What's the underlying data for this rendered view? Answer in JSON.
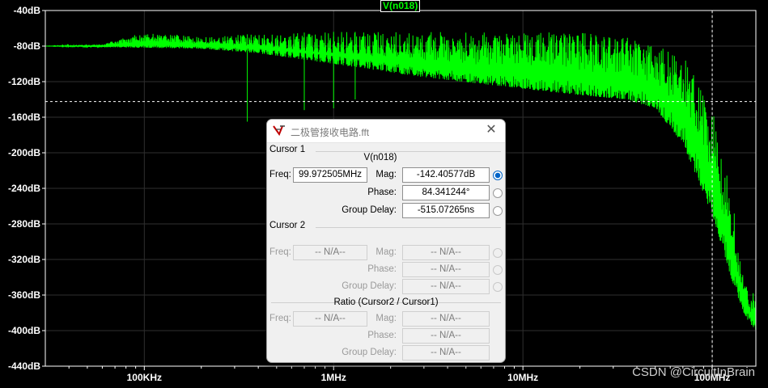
{
  "chart_data": {
    "type": "line",
    "title": "V(n018)",
    "series": [
      {
        "name": "V(n018)",
        "color": "#00ff00"
      }
    ],
    "x_scale": "log",
    "xlim": [
      30000,
      170000000
    ],
    "ylim": [
      -440,
      -40
    ],
    "y_ticks": [
      -40,
      -80,
      -120,
      -160,
      -200,
      -240,
      -280,
      -320,
      -360,
      -400,
      -440
    ],
    "y_tick_labels": [
      "-40dB",
      "-80dB",
      "-120dB",
      "-160dB",
      "-200dB",
      "-240dB",
      "-280dB",
      "-320dB",
      "-360dB",
      "-400dB",
      "-440dB"
    ],
    "x_ticks": [
      100000,
      1000000,
      10000000,
      100000000
    ],
    "x_tick_labels": [
      "100KHz",
      "1MHz",
      "10MHz",
      "100MHz"
    ],
    "grid": true,
    "envelope": {
      "upper": [
        [
          30000,
          -80
        ],
        [
          60000,
          -78
        ],
        [
          80000,
          -70
        ],
        [
          100000,
          -65
        ],
        [
          130000,
          -66
        ],
        [
          200000,
          -70
        ],
        [
          400000,
          -66
        ],
        [
          1000000,
          -64
        ],
        [
          3000000,
          -64
        ],
        [
          10000000,
          -64
        ],
        [
          20000000,
          -65
        ],
        [
          40000000,
          -70
        ],
        [
          70000000,
          -90
        ],
        [
          100000000,
          -150
        ],
        [
          130000000,
          -260
        ],
        [
          140000000,
          -320
        ],
        [
          160000000,
          -360
        ],
        [
          170000000,
          -350
        ]
      ],
      "lower": [
        [
          30000,
          -80
        ],
        [
          200000,
          -83
        ],
        [
          400000,
          -88
        ],
        [
          1000000,
          -100
        ],
        [
          3000000,
          -115
        ],
        [
          10000000,
          -128
        ],
        [
          20000000,
          -135
        ],
        [
          35000000,
          -140
        ],
        [
          50000000,
          -150
        ],
        [
          70000000,
          -190
        ],
        [
          100000000,
          -270
        ],
        [
          130000000,
          -350
        ],
        [
          150000000,
          -385
        ],
        [
          170000000,
          -400
        ]
      ]
    },
    "notches": [
      [
        350000,
        -165
      ],
      [
        700000,
        -152
      ],
      [
        1000000,
        -150
      ],
      [
        1300000,
        -140
      ]
    ],
    "cursor": {
      "x": 99972505,
      "y": -142.40577
    }
  },
  "window": {
    "title": "二极管接收电路.fft",
    "close_glyph": "✕"
  },
  "cursor1": {
    "group_label": "Cursor 1",
    "trace": "V(n018)",
    "freq_label": "Freq:",
    "freq": "99.972505MHz",
    "mag_label": "Mag:",
    "mag": "-142.40577dB",
    "phase_label": "Phase:",
    "phase": "84.341244°",
    "gd_label": "Group Delay:",
    "gd": "-515.07265ns"
  },
  "cursor2": {
    "group_label": "Cursor 2",
    "freq_label": "Freq:",
    "freq": "-- N/A--",
    "mag_label": "Mag:",
    "mag": "-- N/A--",
    "phase_label": "Phase:",
    "phase": "-- N/A--",
    "gd_label": "Group Delay:",
    "gd": "-- N/A--"
  },
  "ratio": {
    "group_label": "Ratio (Cursor2 / Cursor1)",
    "freq_label": "Freq:",
    "freq": "-- N/A--",
    "mag_label": "Mag:",
    "mag": "-- N/A--",
    "phase_label": "Phase:",
    "phase": "-- N/A--",
    "gd_label": "Group Delay:",
    "gd": "-- N/A--"
  },
  "watermark": "CSDN @CircuitInBrain"
}
